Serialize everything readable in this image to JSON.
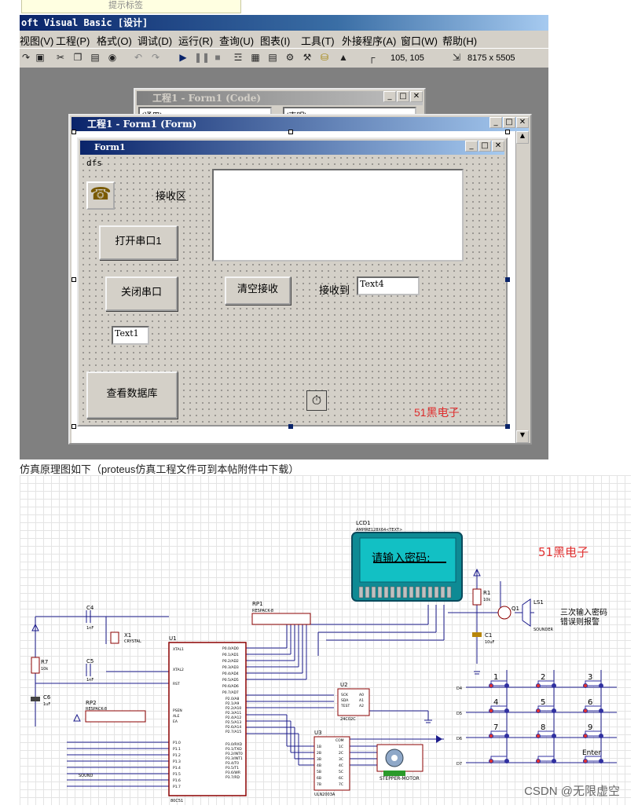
{
  "tooltip": {
    "text": "提示标签"
  },
  "ide": {
    "title": "oft Visual Basic [设计]",
    "menu": [
      "视图(V)",
      "工程(P)",
      "格式(O)",
      "调试(D)",
      "运行(R)",
      "查询(U)",
      "图表(I)",
      "工具(T)",
      "外接程序(A)",
      "窗口(W)",
      "帮助(H)"
    ],
    "position_readout": "105, 105",
    "size_readout": "8175 x 5505"
  },
  "code_window": {
    "title": "工程1 - Form1 (Code)",
    "combo_left": "(通用)",
    "combo_right": "(声明)"
  },
  "form_window": {
    "title": "工程1 - Form1 (Form)"
  },
  "form": {
    "title": "Form1",
    "label_dfs": "dfs",
    "label_receive_area": "接收区",
    "btn_open_port": "打开串口1",
    "btn_close_port": "关闭串口",
    "btn_clear": "清空接收",
    "label_received": "接收到",
    "text4": "Text4",
    "text1": "Text1",
    "btn_view_db": "查看数据库",
    "brand": "51黑电子"
  },
  "caption": "仿真原理图如下（proteus仿真工程文件可到本帖附件中下载）",
  "schematic": {
    "lcd_ref": "LCD1",
    "lcd_part": "AMPIRE128X64<TEXT>",
    "lcd_text": "请输入密码:",
    "brand": "51黑电子",
    "alarm_note_1": "三次输入密码",
    "alarm_note_2": "错误则报警",
    "ls1": "LS1",
    "sounder": "SOUNDER",
    "r1": "R1",
    "r1_val": "10k",
    "c1": "C1",
    "c1_val": "10uF",
    "q1": "Q1",
    "rp1": "RP1",
    "rp1_part": "RESPACK-8",
    "rp2": "RP2",
    "rp2_part": "RESPACK-8",
    "c4": "C4",
    "c4_val": "1nF",
    "c5": "C5",
    "c5_val": "1nF",
    "x1": "X1",
    "x1_part": "CRYSTAL",
    "r7": "R7",
    "r7_val": "10k",
    "c6": "C6",
    "c6_val": "1uF",
    "u1": "U1",
    "u1_part": "80C51",
    "u2": "U2",
    "u2_part": "24C02C",
    "u3": "U3",
    "u3_part": "ULN2003A",
    "motor": "STEPPER-MOTOR",
    "text_tag": "<TEXT>",
    "sound_label": "SOUND",
    "keys": [
      "1",
      "2",
      "3",
      "4",
      "5",
      "6",
      "7",
      "8",
      "9",
      "",
      "Enter",
      ""
    ],
    "row_labels": [
      "D4",
      "D5",
      "D6",
      "D7"
    ],
    "u1_pins_left": [
      "XTAL1",
      "XTAL2",
      "RST",
      "PSEN",
      "ALE",
      "EA",
      "P1.0",
      "P1.1",
      "P1.2",
      "P1.3",
      "P1.4",
      "P1.5",
      "P1.6",
      "P1.7"
    ],
    "u1_pins_right": [
      "P0.0/AD0",
      "P0.1/AD1",
      "P0.2/AD2",
      "P0.3/AD3",
      "P0.4/AD4",
      "P0.5/AD5",
      "P0.6/AD6",
      "P0.7/AD7",
      "P2.0/A8",
      "P2.1/A9",
      "P2.2/A10",
      "P2.3/A11",
      "P2.4/A12",
      "P2.5/A13",
      "P2.6/A14",
      "P2.7/A15",
      "P3.0/RXD",
      "P3.1/TXD",
      "P3.2/INT0",
      "P3.3/INT1",
      "P3.4/T0",
      "P3.5/T1",
      "P3.6/WR",
      "P3.7/RD"
    ],
    "u2_pins": [
      "SCK",
      "SDA",
      "TEST",
      "A0",
      "A1",
      "A2"
    ],
    "u3_pins_left": [
      "1B",
      "2B",
      "3B",
      "4B",
      "5B",
      "6B",
      "7B"
    ],
    "u3_pins_right": [
      "COM",
      "1C",
      "2C",
      "3C",
      "4C",
      "5C",
      "6C",
      "7C"
    ]
  },
  "watermark": "CSDN @无限虚空",
  "colors": {
    "vb_title": "#0a246a",
    "brand_red": "#e03030",
    "lcd_bg": "#10b8b8",
    "face": "#d4d0c8"
  }
}
